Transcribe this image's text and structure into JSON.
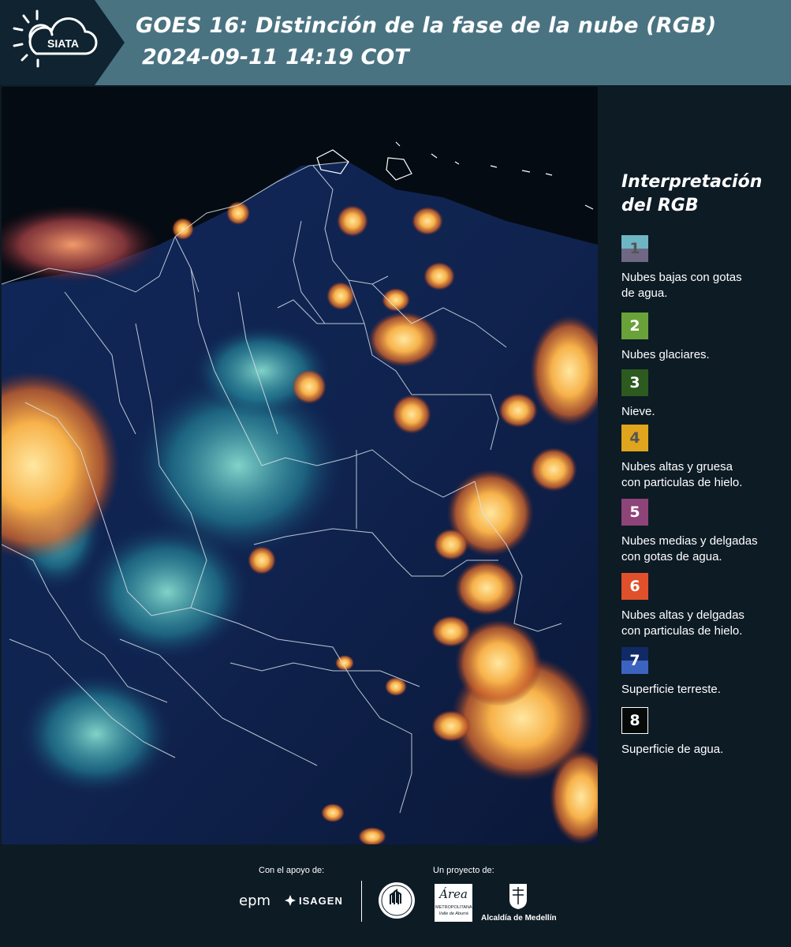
{
  "header": {
    "logo_text": "SIATA",
    "title": "GOES 16: Distinción de la fase de la nube (RGB)",
    "datetime": "2024-09-11 14:19 COT"
  },
  "legend": {
    "title_line1": "Interpretación",
    "title_line2": "del RGB",
    "items": [
      {
        "number": "1",
        "description_1": "Nubes bajas con gotas",
        "description_2": "de agua.",
        "color_top": "#6fb6c4",
        "color_bottom": "#6e6884",
        "num_color": "#555555"
      },
      {
        "number": "2",
        "description_1": "Nubes glaciares.",
        "description_2": "",
        "color_top": "#6aa23a",
        "color_bottom": "#6aa23a",
        "num_color": "#ffffff"
      },
      {
        "number": "3",
        "description_1": "Nieve.",
        "description_2": "",
        "color_top": "#2d5a1e",
        "color_bottom": "#2d5a1e",
        "num_color": "#ffffff"
      },
      {
        "number": "4",
        "description_1": "Nubes altas y gruesa",
        "description_2": "con particulas de hielo.",
        "color_top": "#e0a51c",
        "color_bottom": "#e0a51c",
        "num_color": "#555555"
      },
      {
        "number": "5",
        "description_1": "Nubes medias y delgadas",
        "description_2": "con gotas de agua.",
        "color_top": "#8e4478",
        "color_bottom": "#8e4478",
        "num_color": "#ffffff"
      },
      {
        "number": "6",
        "description_1": "Nubes altas y delgadas",
        "description_2": "con particulas de hielo.",
        "color_top": "#e0502a",
        "color_bottom": "#e0502a",
        "num_color": "#ffffff"
      },
      {
        "number": "7",
        "description_1": "Superficie terreste.",
        "description_2": "",
        "color_top": "#102a66",
        "color_bottom": "#3d63c0",
        "num_color": "#ffffff"
      },
      {
        "number": "8",
        "description_1": "Superficie de agua.",
        "description_2": "",
        "color_top": "#050a08",
        "color_bottom": "#050a08",
        "num_color": "#ffffff"
      }
    ]
  },
  "footer": {
    "support_label": "Con el apoyo de:",
    "project_label": "Un proyecto de:",
    "sponsor_1": "epm",
    "sponsor_2": "ISAGEN",
    "partner_1": "Área Metropolitana Valle de Aburrá",
    "partner_1_line1": "Área",
    "partner_1_line2": "METROPOLITANA",
    "partner_1_line3": "Valle de Aburrá",
    "partner_2": "Alcaldía de Medellín"
  },
  "map": {
    "description": "GOES 16 RGB satellite image over Colombia and Venezuela with department and country borders",
    "colors": {
      "ocean": "#060d14",
      "land": "#0d2150",
      "cloud_warm": "#f2a33a",
      "cloud_glow": "#ffd27a",
      "cyan": "#3cc6c8",
      "border": "#d9e3ea"
    }
  }
}
